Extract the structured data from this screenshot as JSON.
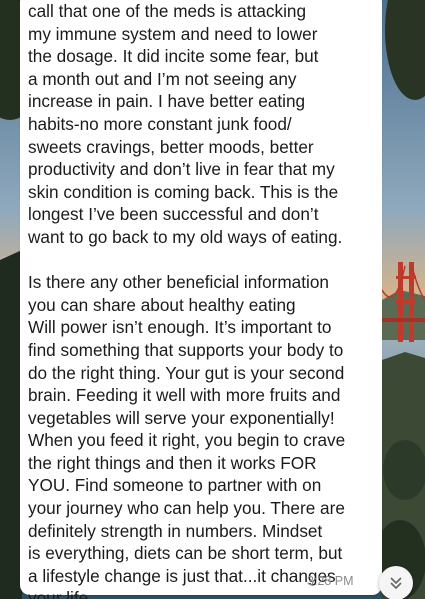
{
  "message": {
    "paragraph1": [
      "call that one of the meds is attacking",
      "my immune system and need to lower",
      "the dosage. It did incite some fear, but",
      "a month out and I’m not seeing any",
      "increase in pain. I have better eating",
      "habits-no more constant junk food/",
      "sweets cravings, better moods, better",
      "productivity and don’t live in fear that my",
      "skin condition is coming back. This is the",
      "longest I’ve been successful and don’t",
      "want to go back to my old ways of eating."
    ],
    "paragraph2": [
      "Is there any other beneficial information",
      "you can share about healthy eating",
      "Will power isn’t enough. It’s important to",
      "find something that supports your body to",
      "do the right thing. Your gut is your second",
      "brain. Feeding it well with more fruits and",
      "vegetables will serve your exponentially!",
      "When you feed it right, you begin to crave",
      "the right things and then it works FOR",
      "YOU. Find someone to partner with on",
      "your journey who can help you. There are",
      "definitely strength in numbers. Mindset",
      "is everything, diets can be short term, but",
      "a lifestyle change is just that...it changes",
      "your life."
    ],
    "timestamp": "3:28 PM"
  },
  "scroll_button": {
    "icon": "double-chevron-down-icon"
  },
  "colors": {
    "bubble": "#ffffff",
    "text": "#1b1b1b",
    "timestamp": "#8a8a8a",
    "bridge": "#c0392b"
  }
}
